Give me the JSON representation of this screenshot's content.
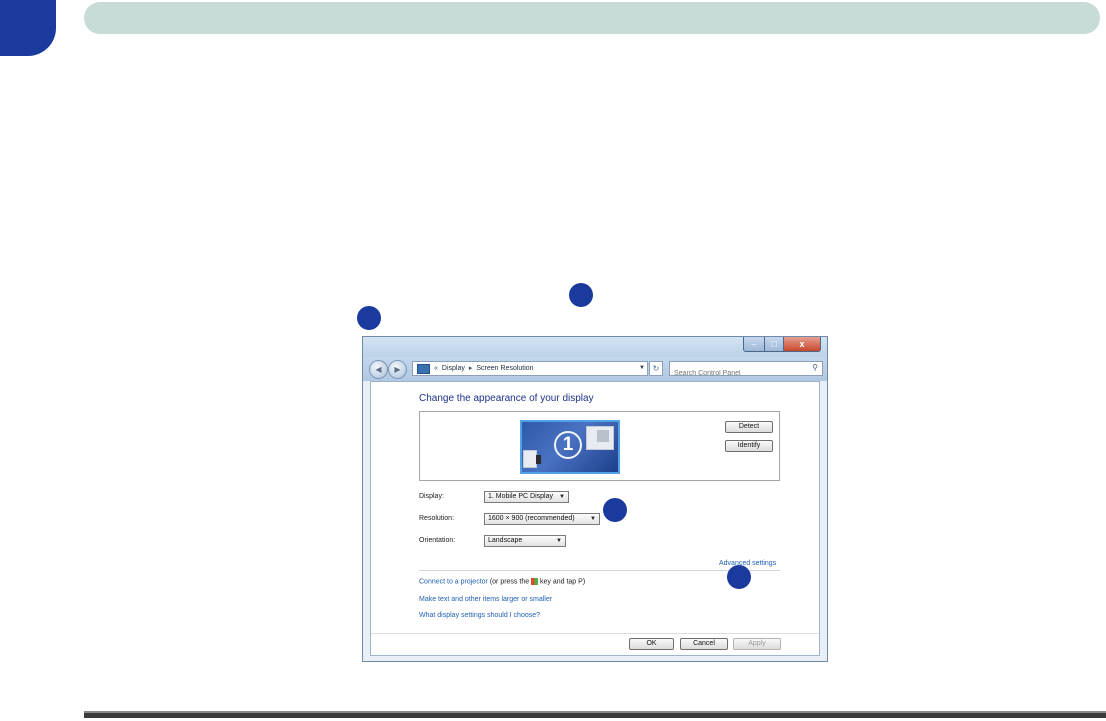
{
  "window": {
    "controls": {
      "minimize": "–",
      "maximize": "□",
      "close": "x"
    }
  },
  "address": {
    "back_symbol": "«",
    "breadcrumb": [
      "Display",
      "Screen Resolution"
    ],
    "separator": "▸",
    "search_placeholder": "Search Control Panel"
  },
  "page": {
    "title": "Change the appearance of your display"
  },
  "preview": {
    "monitor_number": "1",
    "detect_label": "Detect",
    "identify_label": "Identify"
  },
  "fields": {
    "display_label": "Display:",
    "display_value": "1. Mobile PC Display",
    "resolution_label": "Resolution:",
    "resolution_value": "1600 × 900 (recommended)",
    "orientation_label": "Orientation:",
    "orientation_value": "Landscape"
  },
  "links": {
    "advanced_settings": "Advanced settings",
    "connect_projector": "Connect to a projector",
    "connect_suffix_a": " (or press the ",
    "connect_suffix_b": " key and tap P)",
    "text_larger": "Make text and other items larger or smaller",
    "what_settings": "What display settings should I choose?"
  },
  "buttons": {
    "ok": "OK",
    "cancel": "Cancel",
    "apply": "Apply"
  },
  "colors": {
    "callout": "#1a3a9e",
    "header_bar": "#c7dcd6",
    "link": "#1f5fb0",
    "title": "#1e3287"
  }
}
